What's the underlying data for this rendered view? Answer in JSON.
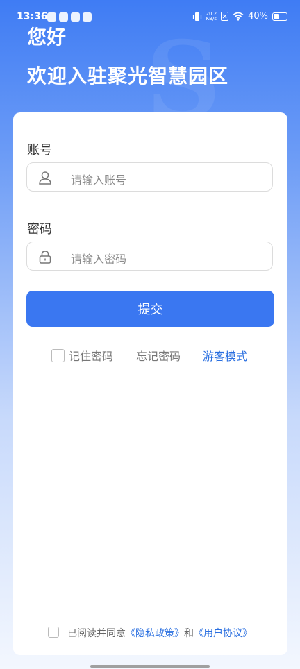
{
  "status_bar": {
    "time": "13:36",
    "net_speed_value": "20.2",
    "net_speed_unit": "KB/s",
    "battery": "40%"
  },
  "header": {
    "greeting": "您好",
    "welcome": "欢迎入驻聚光智慧园区"
  },
  "form": {
    "account_label": "账号",
    "account_placeholder": "请输入账号",
    "password_label": "密码",
    "password_placeholder": "请输入密码",
    "submit_label": "提交",
    "remember_label": "记住密码",
    "forgot_label": "忘记密码",
    "guest_label": "游客模式"
  },
  "agreement": {
    "prefix": "已阅读并同意",
    "privacy": "《隐私政策》",
    "and": "和",
    "terms": "《用户协议》"
  },
  "colors": {
    "primary": "#3a77f1",
    "link": "#2a6fe0"
  },
  "icons": [
    "user-icon",
    "lock-icon",
    "wifi-icon",
    "vibrate-icon",
    "battery-icon"
  ]
}
